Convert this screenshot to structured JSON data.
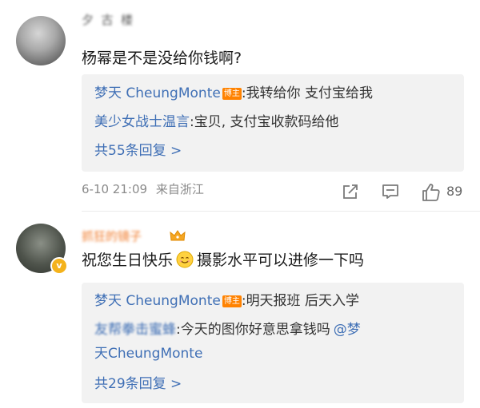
{
  "comments": [
    {
      "username": "夕  古  楼",
      "text": "杨幂是不是没给你钱啊?",
      "replies": [
        {
          "name": "梦天 CheungMonte",
          "badge": "博主",
          "separator": ":",
          "text": "我转给你 支付宝给我"
        },
        {
          "name": "美少女战士温言",
          "separator": ":",
          "text": "宝贝, 支付宝收款码给他"
        }
      ],
      "more": "共55条回复 >",
      "date": "6-10 21:09",
      "location": "来自浙江",
      "likes": "89"
    },
    {
      "username": "抓狂的镜子",
      "text_before": "祝您生日快乐",
      "emoji": "smile-emoji",
      "text_after": "摄影水平可以进修一下吗",
      "replies": [
        {
          "name": "梦天 CheungMonte",
          "badge": "博主",
          "separator": ":",
          "text": "明天报班 后天入学"
        },
        {
          "name": "友帮拳击蜜蜂",
          "separator": ":",
          "text": "今天的图你好意思拿钱吗",
          "mention": "@梦",
          "continuation": "天CheungMonte"
        }
      ],
      "more": "共29条回复 >"
    }
  ],
  "icons": {
    "share": "share-icon",
    "comment": "comment-icon",
    "like": "like-icon",
    "verified": "verified-badge-icon",
    "crown": "crown-icon"
  },
  "verified_letter": "v",
  "colors": {
    "link": "#3f6fb5",
    "badge": "#ff8200",
    "reply_bg": "#f2f2f2",
    "meta": "#8a8a8a"
  }
}
